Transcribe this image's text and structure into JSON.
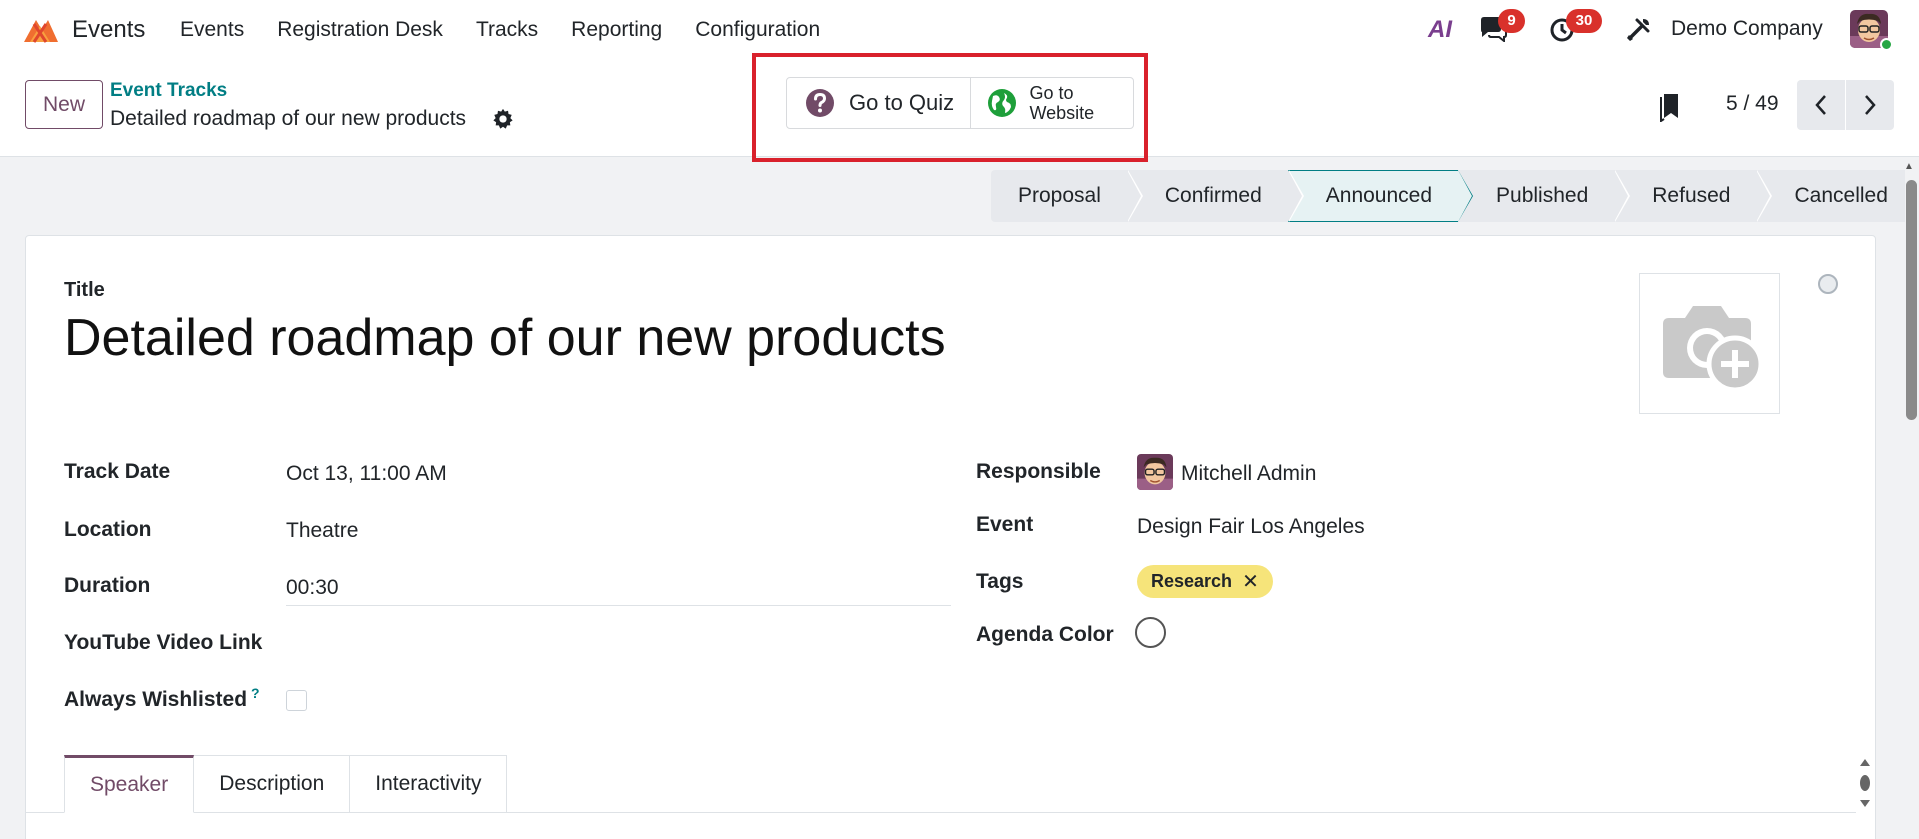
{
  "app": {
    "name": "Events"
  },
  "nav": {
    "menu": [
      "Events",
      "Registration Desk",
      "Tracks",
      "Reporting",
      "Configuration"
    ],
    "ai_label": "AI",
    "messages_count": "9",
    "activities_count": "30",
    "company": "Demo Company"
  },
  "control": {
    "new_label": "New",
    "breadcrumb_parent": "Event Tracks",
    "breadcrumb_current": "Detailed roadmap of our new products",
    "smart_buttons": {
      "quiz_label": "Go to Quiz",
      "website_label": "Go to Website"
    },
    "pager": "5 / 49"
  },
  "statusbar": {
    "stages": [
      "Proposal",
      "Confirmed",
      "Announced",
      "Published",
      "Refused",
      "Cancelled"
    ],
    "active": "Announced"
  },
  "form": {
    "title_label": "Title",
    "title_value": "Detailed roadmap of our new products",
    "left_fields": {
      "track_date_label": "Track Date",
      "track_date_value": "Oct 13, 11:00 AM",
      "location_label": "Location",
      "location_value": "Theatre",
      "duration_label": "Duration",
      "duration_value": "00:30",
      "youtube_label": "YouTube Video Link",
      "wishlisted_label": "Always Wishlisted",
      "wishlisted_help": "?"
    },
    "right_fields": {
      "responsible_label": "Responsible",
      "responsible_value": "Mitchell Admin",
      "event_label": "Event",
      "event_value": "Design Fair Los Angeles",
      "tags_label": "Tags",
      "tag_research": "Research",
      "agenda_color_label": "Agenda Color"
    },
    "tabs": [
      "Speaker",
      "Description",
      "Interactivity"
    ],
    "active_tab": "Speaker"
  },
  "colors": {
    "brand": "#714b67",
    "accent": "#017e84",
    "badge": "#d9312b",
    "highlight": "#d9212c",
    "tag": "#f6e47a"
  },
  "icons": [
    "odoo-logo-icon",
    "ai-icon",
    "chat-icon",
    "clock-icon",
    "tools-icon",
    "gear-icon",
    "question-icon",
    "globe-icon",
    "bookmark-icon",
    "chevron-left-icon",
    "chevron-right-icon",
    "camera-plus-icon"
  ]
}
